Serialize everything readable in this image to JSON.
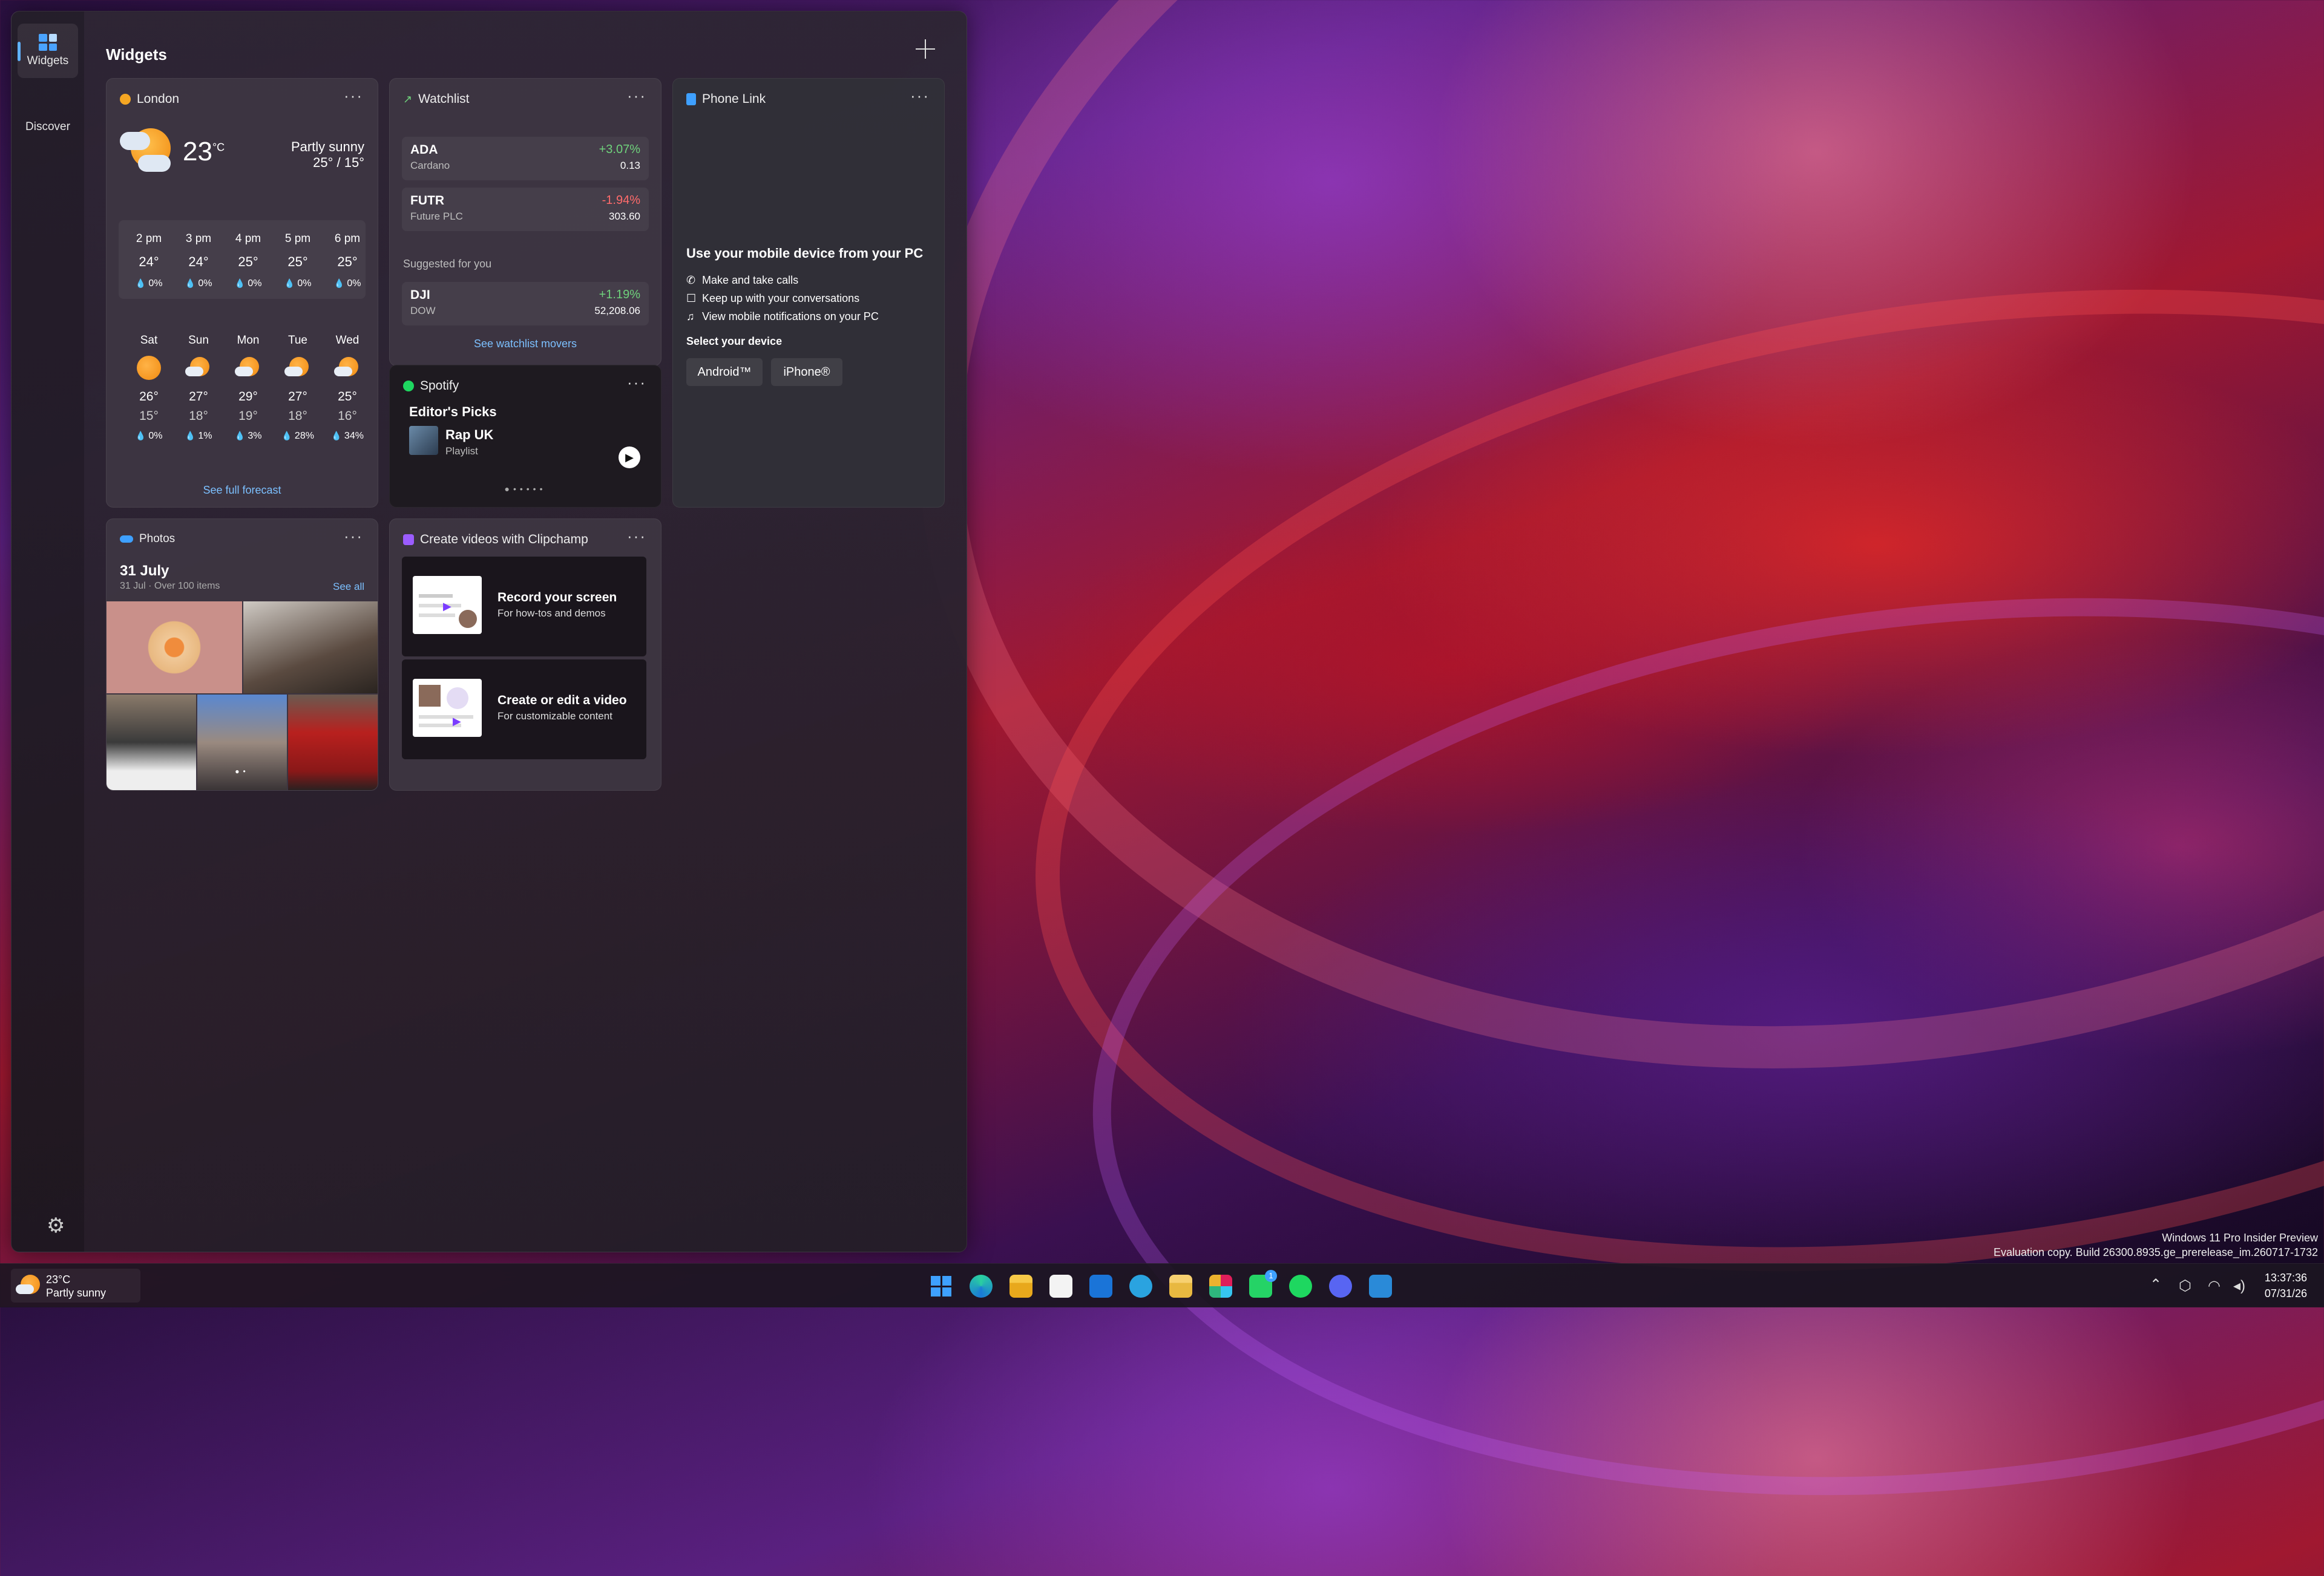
{
  "sidebar": {
    "items": [
      {
        "label": "Widgets",
        "icon": "widgets-icon",
        "active": true
      },
      {
        "label": "Discover",
        "icon": "discover-icon",
        "active": false
      }
    ],
    "settings_icon": "gear-icon"
  },
  "panel": {
    "title": "Widgets",
    "add_icon": "plus-icon"
  },
  "weather": {
    "location": "London",
    "temp": "23",
    "unit": "°C",
    "condition": "Partly sunny",
    "hi_lo": "25° / 15°",
    "hourly": [
      {
        "time": "2 pm",
        "temp": "24°",
        "precip": "0%"
      },
      {
        "time": "3 pm",
        "temp": "24°",
        "precip": "0%"
      },
      {
        "time": "4 pm",
        "temp": "25°",
        "precip": "0%"
      },
      {
        "time": "5 pm",
        "temp": "25°",
        "precip": "0%"
      },
      {
        "time": "6 pm",
        "temp": "25°",
        "precip": "0%"
      }
    ],
    "daily": [
      {
        "day": "Sat",
        "icon": "sun-icon",
        "hi": "26°",
        "lo": "15°",
        "precip": "0%"
      },
      {
        "day": "Sun",
        "icon": "partly-cloudy-icon",
        "hi": "27°",
        "lo": "18°",
        "precip": "1%"
      },
      {
        "day": "Mon",
        "icon": "partly-cloudy-icon",
        "hi": "29°",
        "lo": "19°",
        "precip": "3%"
      },
      {
        "day": "Tue",
        "icon": "partly-cloudy-icon",
        "hi": "27°",
        "lo": "18°",
        "precip": "28%"
      },
      {
        "day": "Wed",
        "icon": "partly-cloudy-icon",
        "hi": "25°",
        "lo": "16°",
        "precip": "34%"
      }
    ],
    "link": "See full forecast"
  },
  "watchlist": {
    "title": "Watchlist",
    "items": [
      {
        "symbol": "ADA",
        "name": "Cardano",
        "change": "+3.07%",
        "price": "0.13",
        "dir": "up"
      },
      {
        "symbol": "FUTR",
        "name": "Future PLC",
        "change": "-1.94%",
        "price": "303.60",
        "dir": "down"
      }
    ],
    "suggested_label": "Suggested for you",
    "suggested": [
      {
        "symbol": "DJI",
        "name": "DOW",
        "change": "+1.19%",
        "price": "52,208.06",
        "dir": "up"
      }
    ],
    "link": "See watchlist movers"
  },
  "phone_link": {
    "title": "Phone Link",
    "heading": "Use your mobile device from your PC",
    "features": [
      {
        "icon": "phone-icon",
        "text": "Make and take calls"
      },
      {
        "icon": "chat-icon",
        "text": "Keep up with your conversations"
      },
      {
        "icon": "bell-icon",
        "text": "View mobile notifications on your PC"
      }
    ],
    "select_label": "Select your device",
    "buttons": [
      "Android™",
      "iPhone®"
    ]
  },
  "spotify": {
    "title": "Spotify",
    "section": "Editor's Picks",
    "playlist": "Rap UK",
    "type": "Playlist"
  },
  "photos": {
    "title": "Photos",
    "date": "31 July",
    "meta": "31 Jul · Over 100 items",
    "see_all": "See all"
  },
  "clipchamp": {
    "title": "Create videos with Clipchamp",
    "items": [
      {
        "title": "Record your screen",
        "sub": "For how-tos and demos"
      },
      {
        "title": "Create or edit a video",
        "sub": "For customizable content"
      }
    ]
  },
  "taskbar": {
    "weather_temp": "23°C",
    "weather_text": "Partly sunny",
    "whatsapp_badge": "1",
    "time": "13:37:36",
    "date": "07/31/26"
  },
  "watermark": {
    "line1": "Windows 11 Pro Insider Preview",
    "line2": "Evaluation copy. Build 26300.8935.ge_prerelease_im.260717-1732"
  },
  "colors": {
    "accent": "#5fb2ff",
    "up": "#6fd27c",
    "down": "#ff6b6b",
    "spotify": "#1ed760"
  }
}
